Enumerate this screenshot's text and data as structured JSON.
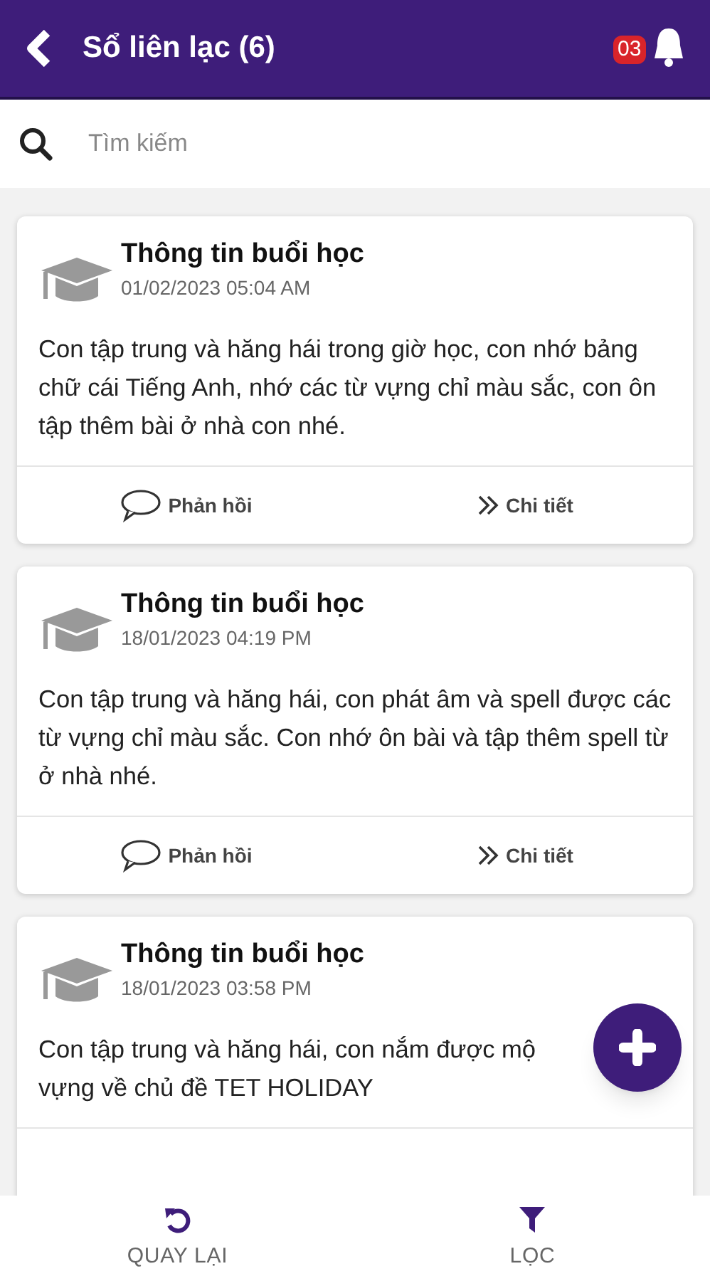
{
  "header": {
    "title": "Sổ liên lạc (6)",
    "notification_count": "03"
  },
  "search": {
    "placeholder": "Tìm kiếm"
  },
  "cards": [
    {
      "title": "Thông tin buổi học",
      "date": "01/02/2023 05:04 AM",
      "body": "Con tập trung và hăng hái trong giờ học, con nhớ bảng chữ cái Tiếng Anh, nhớ các từ vựng chỉ màu sắc, con ôn tập thêm bài ở nhà con nhé.",
      "actions": [
        "Phản hồi",
        "Chi tiết"
      ]
    },
    {
      "title": "Thông tin buổi học",
      "date": "18/01/2023 04:19 PM",
      "body": "Con tập trung và hăng hái, con phát âm và spell được các từ vựng chỉ màu sắc. Con nhớ ôn bài và tập thêm spell từ ở nhà nhé.",
      "actions": [
        "Phản hồi",
        "Chi tiết"
      ]
    },
    {
      "title": "Thông tin buổi học",
      "date": "18/01/2023 03:58 PM",
      "body_parts": [
        "Con tập trung và hăng hái, con nắm được mộ",
        "vựng về chủ đề TET HOLIDAY"
      ]
    }
  ],
  "bottom_nav": [
    {
      "label": "QUAY LẠI",
      "kind": "back"
    },
    {
      "label": "LỌC",
      "kind": "filter"
    }
  ]
}
